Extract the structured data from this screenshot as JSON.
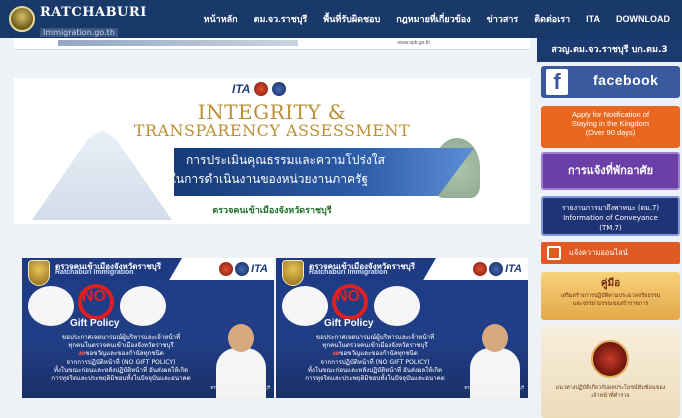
{
  "brand": {
    "title": "RATCHABURI",
    "domain": "Immigration.go.th"
  },
  "nav": {
    "items": [
      "หน้าหลัก",
      "ตม.จว.ราชบุรี",
      "พื้นที่รับผิดชอบ",
      "กฎหมายที่เกี่ยวข้อง",
      "ข่าวสาร",
      "ติดต่อเรา",
      "ITA",
      "DOWNLOAD"
    ]
  },
  "top_strip": {
    "url": "www.spb.go.th"
  },
  "ita_banner": {
    "logo_text": "ITA",
    "title_line1": "INTEGRITY &",
    "title_line2": "TRANSPARENCY ASSESSMENT",
    "thai_line1": "การประเมินคุณธรรมและความโปร่งใส",
    "thai_line2": "ในการดำเนินงานของหน่วยงานภาครัฐ",
    "footer": "ตรวจคนเข้าเมืองจังหวัดราชบุรี"
  },
  "gift_policy": {
    "header_th": "ตรวจคนเข้าเมืองจังหวัดราชบุรี",
    "header_en": "Ratchaburi Immigration",
    "ita_text": "ITA",
    "no_text": "NO",
    "policy": "Gift Policy",
    "line1": "ขอประกาศเจตนารมณ์ผู้บริหารและเจ้าหน้าที่",
    "line2": "ทุกคนในตรวจคนเข้าเมืองจังหวัดราชบุรี",
    "line3_red": "งด",
    "line3_rest": "ขอขวัญและของกำนัลทุกชนิด",
    "line4": "จากการปฏิบัติหน้าที่ (NO GIFT POLICY)",
    "line5": "ทั้งในขณะก่อนและหลังปฏิบัติหน้าที่ อันส่งผลให้เกิด",
    "line6": "การทุจริตและประพฤติมิชอบทั้งในปัจจุบันและอนาคต",
    "caption": "ตรวจคนเข้าเมืองจังหวัดราชบุรี"
  },
  "sidebar": {
    "heading": "สวญ.ตม.จว.ราชบุรี บก.ตม.3",
    "facebook": "facebook",
    "fb_icon": "f",
    "ninety_line1": "Apply for Notification of",
    "ninety_line2": "Staying in the Kingdom",
    "ninety_line3": "(Over 90 days)",
    "address": "การแจ้งที่พักอาศัย",
    "tm_line1": "รายงานการมาถึงพาหนะ (ตม.7)",
    "tm_line2": "Information of Conveyance",
    "tm_line3": "(TM.7)",
    "online": "แจ้งความออนไลน์",
    "guide_title": "คู่มือ",
    "guide_line1": "เสริมสร้างการปฏิบัติตามประมวลจริยธรรม",
    "guide_line2": "และจรรยาบรรณของข้าราชการ",
    "manual_line1": "แนวทางปฏิบัติเกี่ยวกับผลประโยชน์ทับซ้อนของ",
    "manual_line2": "เจ้าหน้าที่ตำรวจ"
  }
}
